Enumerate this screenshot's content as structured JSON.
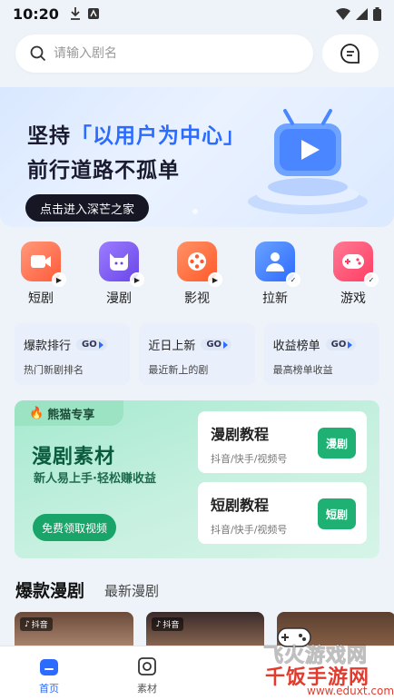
{
  "status_bar": {
    "time": "10:20"
  },
  "search": {
    "placeholder": "请输入剧名",
    "value": ""
  },
  "banner": {
    "line1_prefix": "坚持",
    "line1_highlight": "「以用户为中心」",
    "line2": "前行道路不孤单",
    "cta": "点击进入深芒之家"
  },
  "categories": [
    {
      "label": "短剧",
      "icon": "camera-icon",
      "color": "#ff7452"
    },
    {
      "label": "漫剧",
      "icon": "cat-icon",
      "color": "#7b59f3"
    },
    {
      "label": "影视",
      "icon": "film-reel-icon",
      "color": "#ff6a3d"
    },
    {
      "label": "拉新",
      "icon": "user-add-icon",
      "color": "#3b7bff"
    },
    {
      "label": "游戏",
      "icon": "gamepad-icon",
      "color": "#ff4a6b"
    }
  ],
  "rankings": [
    {
      "title": "爆款排行",
      "go": "GO",
      "sub": "热门新剧排名"
    },
    {
      "title": "近日上新",
      "go": "GO",
      "sub": "最近新上的剧"
    },
    {
      "title": "收益榜单",
      "go": "GO",
      "sub": "最高榜单收益"
    }
  ],
  "promo": {
    "tag": "熊猫专享",
    "title": "漫剧素材",
    "subtitle": "新人易上手·轻松赚收益",
    "button": "免费领取视频",
    "tutorials": [
      {
        "title": "漫剧教程",
        "sub": "抖音/快手/视频号",
        "button": "漫剧"
      },
      {
        "title": "短剧教程",
        "sub": "抖音/快手/视频号",
        "button": "短剧"
      }
    ]
  },
  "section_tabs": {
    "active": "爆款漫剧",
    "inactive": "最新漫剧"
  },
  "cards": [
    {
      "tag": "抖音"
    },
    {
      "tag": "抖音"
    }
  ],
  "bottom_nav": [
    {
      "label": "首页",
      "icon": "home-icon",
      "active": true
    },
    {
      "label": "素材",
      "icon": "material-icon",
      "active": false
    }
  ],
  "watermark": {
    "line1": "飞火游戏网",
    "line2": "千饭手游网",
    "url": "www.eduxt.com"
  },
  "colors": {
    "accent": "#2c6bff",
    "green": "#19a469"
  }
}
